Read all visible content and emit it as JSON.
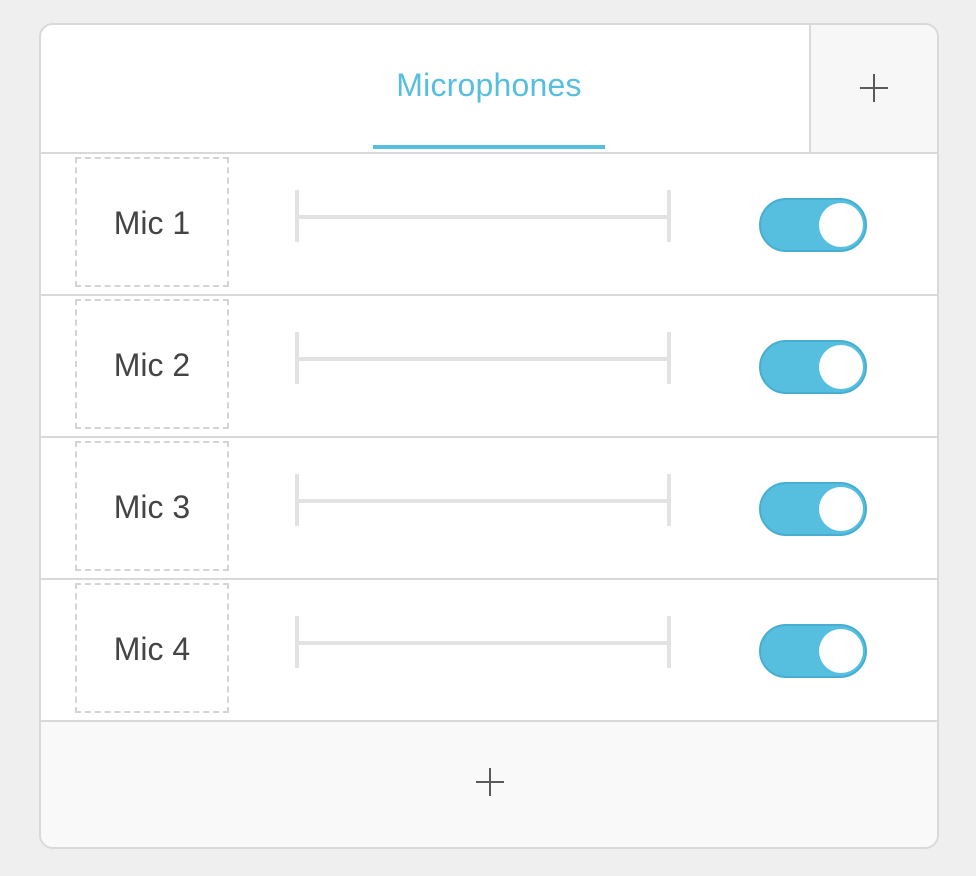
{
  "header": {
    "tab_label": "Microphones",
    "add_button_icon": "plus-icon"
  },
  "microphones": [
    {
      "label": "Mic 1",
      "enabled": true
    },
    {
      "label": "Mic 2",
      "enabled": true
    },
    {
      "label": "Mic 3",
      "enabled": true
    },
    {
      "label": "Mic 4",
      "enabled": true
    }
  ],
  "footer": {
    "add_button_icon": "plus-icon"
  },
  "colors": {
    "accent": "#56bfe0",
    "border": "#d9d9d9",
    "text": "#444444",
    "background": "#efefef"
  }
}
